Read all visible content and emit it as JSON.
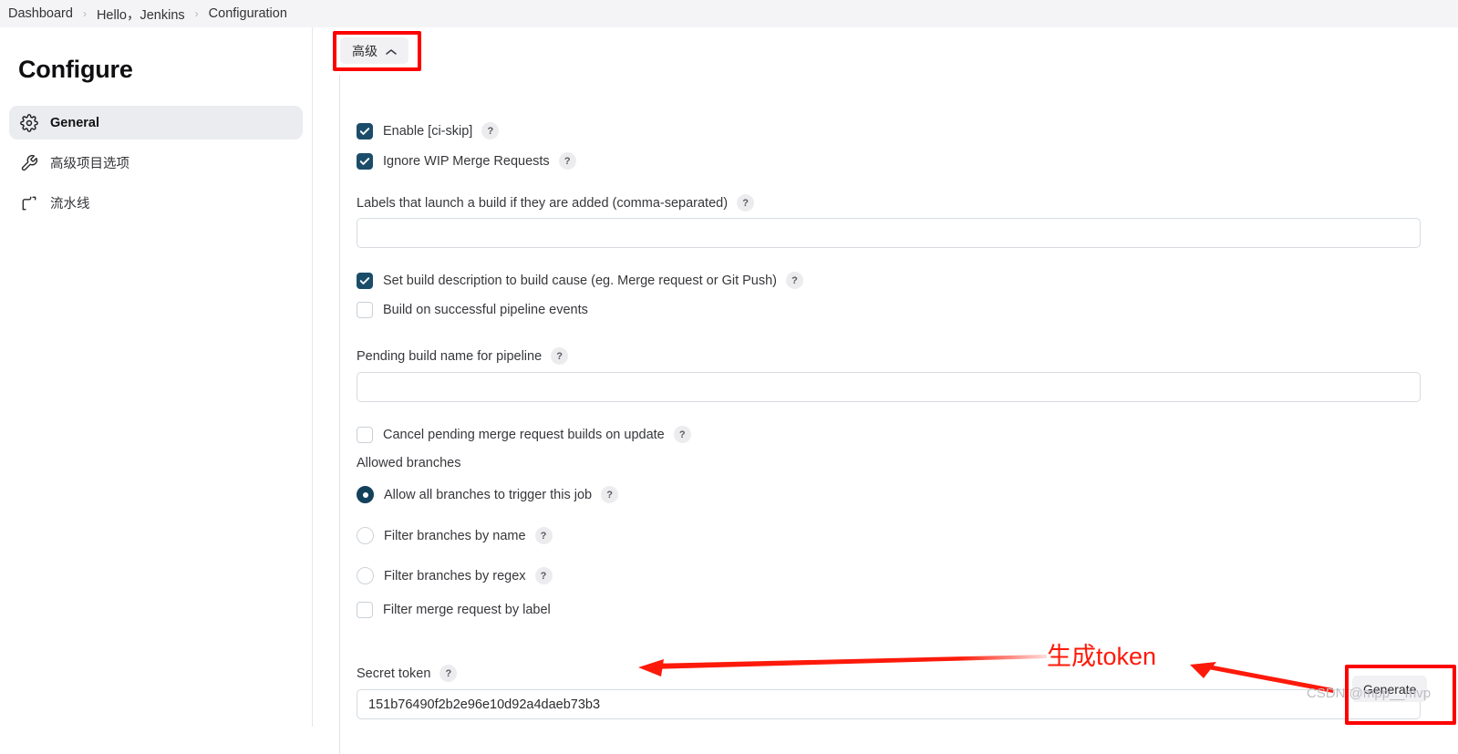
{
  "breadcrumb": {
    "items": [
      "Dashboard",
      "Hello，Jenkins",
      "Configuration"
    ],
    "separator": "›"
  },
  "sidebar": {
    "title": "Configure",
    "items": [
      {
        "label": "General",
        "icon": "gear-icon",
        "active": true
      },
      {
        "label": "高级项目选项",
        "icon": "wrench-icon",
        "active": false
      },
      {
        "label": "流水线",
        "icon": "pipeline-icon",
        "active": false
      }
    ]
  },
  "toolbar": {
    "advanced_label": "高级",
    "advanced_chevron": "chevron-up-icon"
  },
  "form": {
    "help_glyph": "?",
    "enable_ci_skip": {
      "label": "Enable [ci-skip]",
      "checked": true,
      "help": "?"
    },
    "ignore_wip": {
      "label": "Ignore WIP Merge Requests",
      "checked": true,
      "help": "?"
    },
    "labels_field": {
      "label": "Labels that launch a build if they are added (comma-separated)",
      "help": "?",
      "value": "",
      "placeholder": ""
    },
    "set_build_description": {
      "label": "Set build description to build cause (eg. Merge request or Git Push)",
      "checked": true,
      "help": "?"
    },
    "build_on_pipeline_events": {
      "label": "Build on successful pipeline events",
      "checked": false
    },
    "pending_build_name": {
      "label": "Pending build name for pipeline",
      "help": "?",
      "value": "",
      "placeholder": ""
    },
    "cancel_pending": {
      "label": "Cancel pending merge request builds on update",
      "checked": false,
      "help": "?"
    },
    "allowed_branches_label": "Allowed branches",
    "radios": [
      {
        "label": "Allow all branches to trigger this job",
        "selected": true,
        "help": "?"
      },
      {
        "label": "Filter branches by name",
        "selected": false,
        "help": "?"
      },
      {
        "label": "Filter branches by regex",
        "selected": false,
        "help": "?"
      }
    ],
    "filter_by_label": {
      "label": "Filter merge request by label",
      "checked": false
    },
    "secret_token": {
      "label": "Secret token",
      "help": "?",
      "value": "151b76490f2b2e96e10d92a4daeb73b3",
      "placeholder": ""
    },
    "generate_label": "Generate"
  },
  "annotations": {
    "note_text": "生成token",
    "watermark": "CSDN @mpp__mvp",
    "highlight_color": "#fd0000",
    "note_color": "#fd1a0a"
  }
}
